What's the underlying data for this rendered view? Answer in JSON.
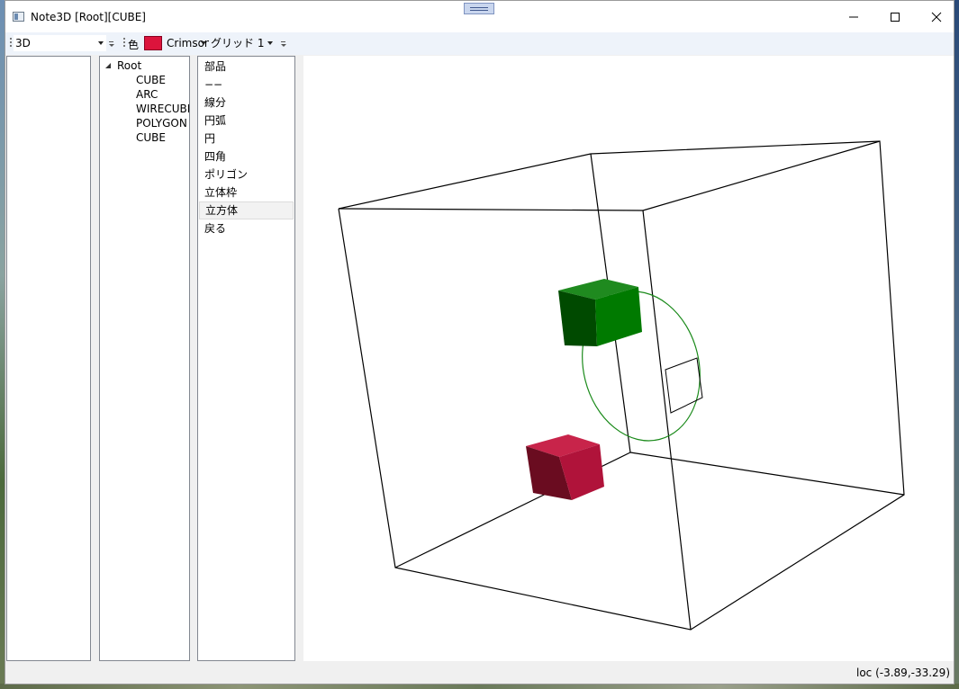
{
  "window": {
    "title": "Note3D [Root][CUBE]"
  },
  "toolbar": {
    "mode_value": "3D",
    "color_label": "色",
    "color_value": "Crimson",
    "color_hex": "#DC143C",
    "grid_value": "グリッド 1"
  },
  "tree": {
    "root": "Root",
    "children": [
      "CUBE",
      "ARC",
      "WIRECUBE",
      "POLYGON",
      "CUBE"
    ]
  },
  "commands": {
    "items": [
      "部品",
      "−−",
      "線分",
      "円弧",
      "円",
      "四角",
      "ポリゴン",
      "立体枠",
      "立方体",
      "戻る"
    ],
    "selected": "立方体"
  },
  "scene": {
    "green_cube_color": "#007a00",
    "red_cube_color": "#b0133a",
    "wire_color": "#000000",
    "arc_color": "#1a8a1a"
  },
  "status": {
    "location": "loc (-3.89,-33.29)"
  }
}
